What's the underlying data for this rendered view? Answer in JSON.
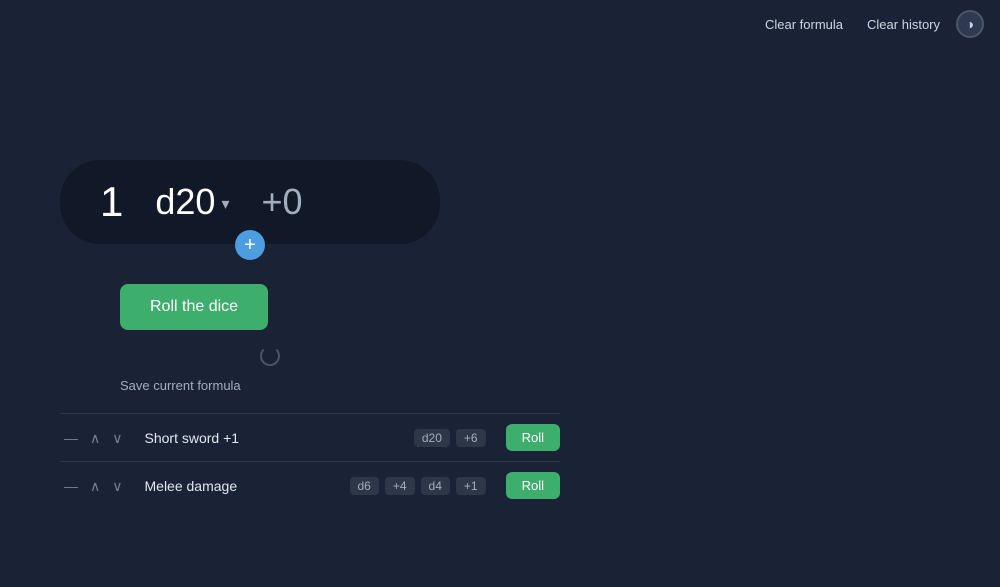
{
  "nav": {
    "clear_formula_label": "Clear formula",
    "clear_history_label": "Clear history"
  },
  "dice_roller": {
    "count": "1",
    "type": "d20",
    "modifier": "+0",
    "add_icon": "+"
  },
  "roll_button": {
    "label": "Roll the dice"
  },
  "save_formula_label": "Save current formula",
  "formulas": [
    {
      "name": "Short sword +1",
      "dice": [
        {
          "label": "d20"
        },
        {
          "label": "+6"
        }
      ],
      "roll_label": "Roll"
    },
    {
      "name": "Melee damage",
      "dice": [
        {
          "label": "d6"
        },
        {
          "label": "+4"
        },
        {
          "label": "d4"
        },
        {
          "label": "+1"
        }
      ],
      "roll_label": "Roll"
    }
  ],
  "icons": {
    "chevron_down": "▾",
    "minus": "—",
    "up": "∧",
    "down": "∨",
    "theme_toggle": "◑"
  }
}
